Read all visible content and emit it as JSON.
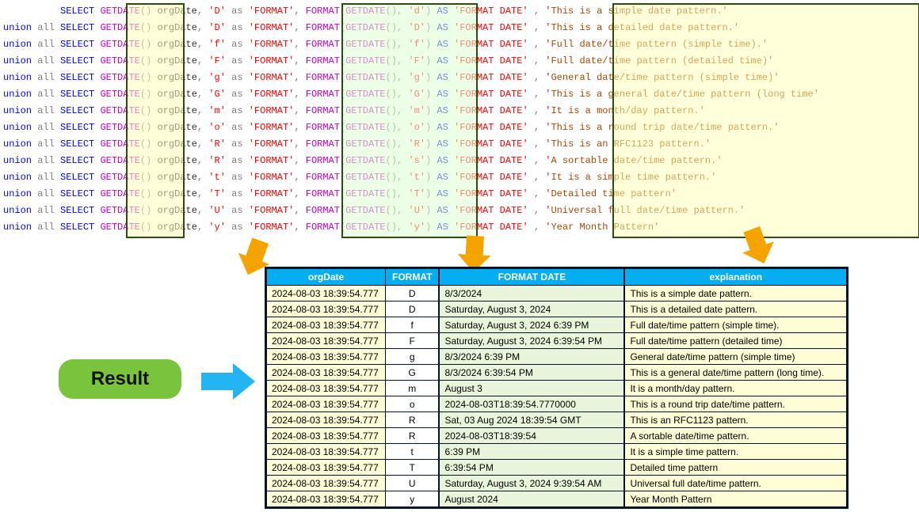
{
  "result_badge": "Result",
  "code": {
    "rows": [
      {
        "prefix": "          ",
        "fmt": "D",
        "res": "d",
        "explain": "This is a simple date pattern."
      },
      {
        "prefix": "union all ",
        "fmt": "D",
        "res": "D",
        "explain": "This is a detailed date pattern."
      },
      {
        "prefix": "union all ",
        "fmt": "f",
        "res": "f",
        "explain": "Full date/time pattern (simple time)."
      },
      {
        "prefix": "union all ",
        "fmt": "F",
        "res": "F",
        "explain": "Full date/time pattern (detailed time)"
      },
      {
        "prefix": "union all ",
        "fmt": "g",
        "res": "g",
        "explain": "General date/time pattern (simple time)"
      },
      {
        "prefix": "union all ",
        "fmt": "G",
        "res": "G",
        "explain": "This is a general date/time pattern (long time"
      },
      {
        "prefix": "union all ",
        "fmt": "m",
        "res": "m",
        "explain": "It is a month/day pattern."
      },
      {
        "prefix": "union all ",
        "fmt": "o",
        "res": "o",
        "explain": "This is a round trip date/time pattern."
      },
      {
        "prefix": "union all ",
        "fmt": "R",
        "res": "R",
        "explain": "This is an RFC1123 pattern."
      },
      {
        "prefix": "union all ",
        "fmt": "R",
        "res": "s",
        "explain": "A sortable date/time pattern."
      },
      {
        "prefix": "union all ",
        "fmt": "t",
        "res": "t",
        "explain": "It is a simple time pattern."
      },
      {
        "prefix": "union all ",
        "fmt": "T",
        "res": "T",
        "explain": "Detailed time pattern"
      },
      {
        "prefix": "union all ",
        "fmt": "U",
        "res": "U",
        "explain": "Universal full date/time pattern."
      },
      {
        "prefix": "union all ",
        "fmt": "y",
        "res": "y",
        "explain": "Year Month Pattern"
      }
    ]
  },
  "table": {
    "headers": {
      "orgDate": "orgDate",
      "format": "FORMAT",
      "formatDate": "FORMAT DATE",
      "explanation": "explanation"
    },
    "rows": [
      {
        "orgDate": "2024-08-03 18:39:54.777",
        "fmt": "D",
        "fmtDate": "8/3/2024",
        "exp": "This is a simple date pattern."
      },
      {
        "orgDate": "2024-08-03 18:39:54.777",
        "fmt": "D",
        "fmtDate": "Saturday, August 3, 2024",
        "exp": "This is a detailed date pattern."
      },
      {
        "orgDate": "2024-08-03 18:39:54.777",
        "fmt": "f",
        "fmtDate": "Saturday, August 3, 2024 6:39 PM",
        "exp": "Full date/time pattern (simple time)."
      },
      {
        "orgDate": "2024-08-03 18:39:54.777",
        "fmt": "F",
        "fmtDate": "Saturday, August 3, 2024 6:39:54 PM",
        "exp": "Full date/time pattern (detailed time)"
      },
      {
        "orgDate": "2024-08-03 18:39:54.777",
        "fmt": "g",
        "fmtDate": "8/3/2024 6:39 PM",
        "exp": "General date/time pattern (simple time)"
      },
      {
        "orgDate": "2024-08-03 18:39:54.777",
        "fmt": "G",
        "fmtDate": "8/3/2024 6:39:54 PM",
        "exp": "This is a general date/time pattern (long time)."
      },
      {
        "orgDate": "2024-08-03 18:39:54.777",
        "fmt": "m",
        "fmtDate": "August 3",
        "exp": "It is a month/day pattern."
      },
      {
        "orgDate": "2024-08-03 18:39:54.777",
        "fmt": "o",
        "fmtDate": "2024-08-03T18:39:54.7770000",
        "exp": "This is a round trip date/time pattern."
      },
      {
        "orgDate": "2024-08-03 18:39:54.777",
        "fmt": "R",
        "fmtDate": "Sat, 03 Aug 2024 18:39:54 GMT",
        "exp": "This is an RFC1123 pattern."
      },
      {
        "orgDate": "2024-08-03 18:39:54.777",
        "fmt": "R",
        "fmtDate": "2024-08-03T18:39:54",
        "exp": "A sortable date/time pattern."
      },
      {
        "orgDate": "2024-08-03 18:39:54.777",
        "fmt": "t",
        "fmtDate": "6:39 PM",
        "exp": "It is a simple time pattern."
      },
      {
        "orgDate": "2024-08-03 18:39:54.777",
        "fmt": "T",
        "fmtDate": "6:39:54 PM",
        "exp": "Detailed time pattern"
      },
      {
        "orgDate": "2024-08-03 18:39:54.777",
        "fmt": "U",
        "fmtDate": "Saturday, August 3, 2024 9:39:54 AM",
        "exp": "Universal full date/time pattern."
      },
      {
        "orgDate": "2024-08-03 18:39:54.777",
        "fmt": "y",
        "fmtDate": "August 2024",
        "exp": "Year Month Pattern"
      }
    ]
  }
}
